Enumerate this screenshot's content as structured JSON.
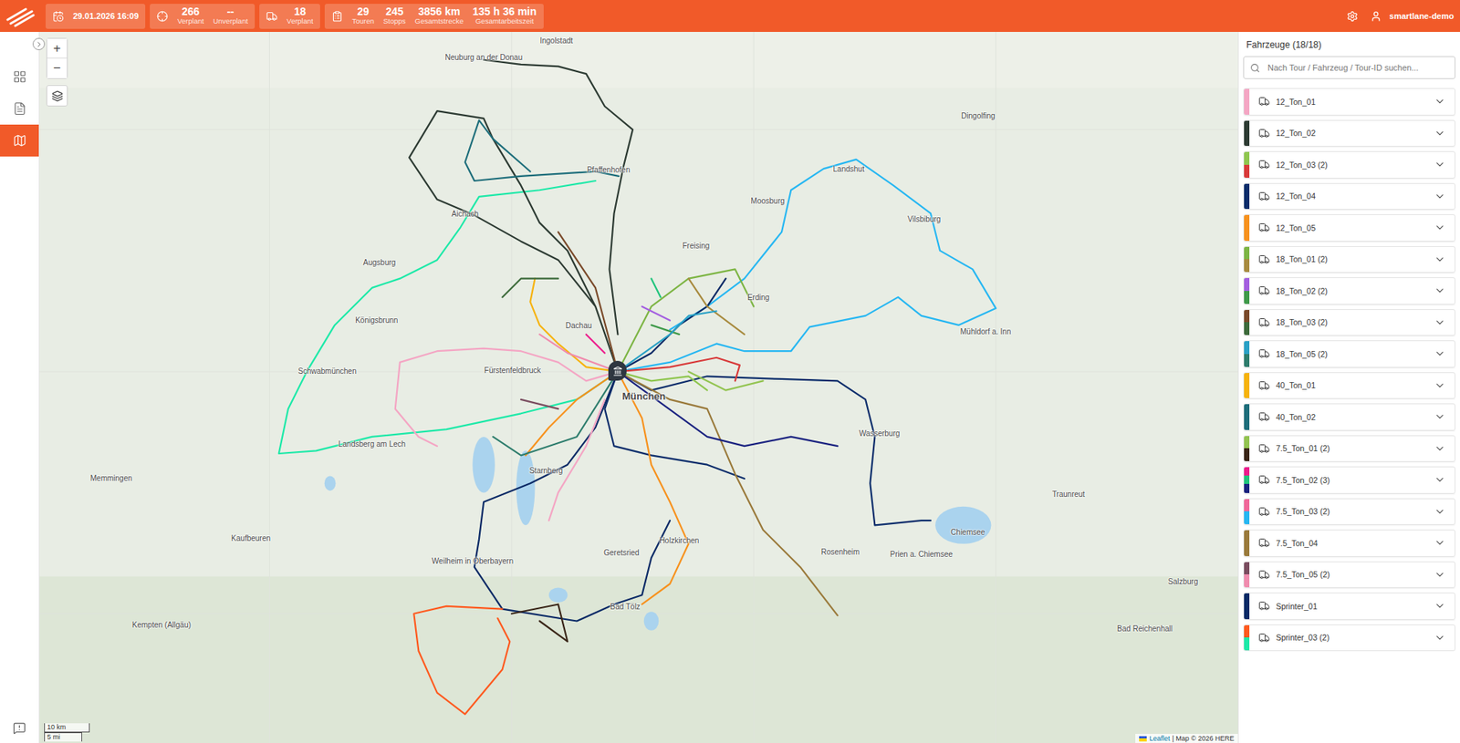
{
  "topbar": {
    "chips": [
      {
        "items": [
          {
            "value": "29.01.2026 16:09"
          }
        ]
      },
      {
        "items": [
          {
            "value": "266",
            "label": "Verplant"
          },
          {
            "value": "--",
            "label": "Unverplant"
          }
        ]
      },
      {
        "items": [
          {
            "value": "18",
            "label": "Verplant"
          }
        ]
      },
      {
        "items": [
          {
            "value": "29",
            "label": "Touren"
          },
          {
            "value": "245",
            "label": "Stopps"
          },
          {
            "value": "3856 km",
            "label": "Gesamtstrecke"
          },
          {
            "value": "135 h 36 min",
            "label": "Gesamtarbeitszeit"
          }
        ]
      }
    ],
    "user": "smartlane-demo"
  },
  "nav": [
    {
      "selected": false
    },
    {
      "selected": false
    },
    {
      "selected": true
    }
  ],
  "map": {
    "zoom_in": "+",
    "zoom_out": "−",
    "scale": [
      "10 km",
      "5 mi"
    ],
    "attribution": [
      "Leaflet",
      "| Map © 2026 HERE"
    ],
    "places": [
      "Ingolstadt",
      "Neuburg an der Donau",
      "Augsburg",
      "München",
      "Freising",
      "Landshut",
      "Dingolfing",
      "Pfaffenhofen",
      "Dachau",
      "Erding",
      "Fürstenfeldbruck",
      "Starnberg",
      "Landsberg am Lech",
      "Weilheim in Oberbayern",
      "Bad Tölz",
      "Holzkirchen",
      "Rosenheim",
      "Wasserburg",
      "Mühldorf a. Inn",
      "Vilsbiburg",
      "Moosburg",
      "Aichach",
      "Kaufbeuren",
      "Memmingen",
      "Kempten (Allgäu)",
      "Traunreut",
      "Prien a. Chiemsee",
      "Chiemsee",
      "Salzburg",
      "Bad Reichenhall",
      "Schwabmünchen",
      "Königsbrunn",
      "Geretsried"
    ]
  },
  "panel": {
    "title": "Fahrzeuge (18/18)",
    "search_placeholder": "Nach Tour / Fahrzeug / Tour-ID suchen...",
    "vehicles": [
      {
        "name": "12_Ton_01",
        "colors": [
          "#f4a6c4"
        ],
        "expanded": false
      },
      {
        "name": "12_Ton_02",
        "colors": [
          "#2d3b33"
        ],
        "expanded": false
      },
      {
        "name": "12_Ton_03",
        "count": "(2)",
        "colors": [
          "#8fc64f",
          "#d83a3a"
        ],
        "expanded": false
      },
      {
        "name": "12_Ton_04",
        "colors": [
          "#0c2d6b"
        ],
        "expanded": false
      },
      {
        "name": "12_Ton_05",
        "colors": [
          "#f7921e"
        ],
        "expanded": false
      },
      {
        "name": "18_Ton_01",
        "count": "(2)",
        "colors": [
          "#7db544",
          "#a88b3f"
        ],
        "expanded": false
      },
      {
        "name": "18_Ton_02",
        "count": "(2)",
        "colors": [
          "#a45fe0",
          "#3f9a4a"
        ],
        "expanded": false
      },
      {
        "name": "18_Ton_03",
        "count": "(2)",
        "colors": [
          "#7a4a2a",
          "#3d6b3b"
        ],
        "expanded": false
      },
      {
        "name": "18_Ton_05",
        "count": "(2)",
        "colors": [
          "#2aa1c6",
          "#2e7d6d"
        ],
        "expanded": false
      },
      {
        "name": "40_Ton_01",
        "colors": [
          "#f6b30f"
        ],
        "expanded": false
      },
      {
        "name": "40_Ton_02",
        "colors": [
          "#1e6e7b"
        ],
        "expanded": false
      },
      {
        "name": "7.5_Ton_01",
        "count": "(2)",
        "colors": [
          "#93c451",
          "#3a2618"
        ],
        "expanded": false
      },
      {
        "name": "7.5_Ton_02",
        "count": "(3)",
        "colors": [
          "#ec1c8c",
          "#21c47c",
          "#1b2380"
        ],
        "expanded": false
      },
      {
        "name": "7.5_Ton_03",
        "count": "(2)",
        "colors": [
          "#f0689a",
          "#27b7f2"
        ],
        "expanded": false
      },
      {
        "name": "7.5_Ton_04",
        "colors": [
          "#9a7a3b"
        ],
        "expanded": false
      },
      {
        "name": "7.5_Ton_05",
        "count": "(2)",
        "colors": [
          "#7b4d60",
          "#f08cae"
        ],
        "expanded": false
      },
      {
        "name": "Sprinter_01",
        "colors": [
          "#0a2a66"
        ],
        "expanded": false
      },
      {
        "name": "Sprinter_03",
        "count": "(2)",
        "colors": [
          "#ff5a1f",
          "#1de9a8"
        ],
        "expanded": false
      }
    ]
  }
}
